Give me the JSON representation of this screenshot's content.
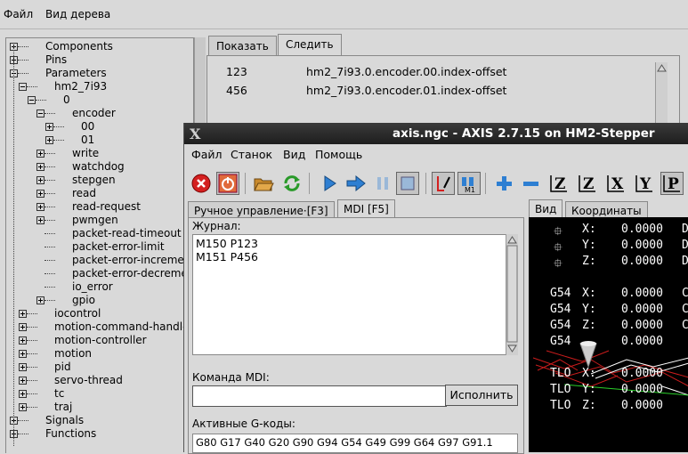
{
  "main_menu": {
    "file": "Файл",
    "tree_view": "Вид дерева"
  },
  "tree": [
    {
      "label": "Components",
      "expanded": false
    },
    {
      "label": "Pins",
      "expanded": false
    },
    {
      "label": "Parameters",
      "expanded": true
    },
    {
      "label": "hm2_7i93",
      "expanded": true
    },
    {
      "label": "0",
      "expanded": true
    },
    {
      "label": "encoder",
      "expanded": true
    },
    {
      "label": "00",
      "expanded": false
    },
    {
      "label": "01",
      "expanded": false
    },
    {
      "label": "write",
      "expanded": false
    },
    {
      "label": "watchdog",
      "expanded": false
    },
    {
      "label": "stepgen",
      "expanded": false
    },
    {
      "label": "read",
      "expanded": false
    },
    {
      "label": "read-request",
      "expanded": false
    },
    {
      "label": "pwmgen",
      "expanded": false
    },
    {
      "label": "packet-read-timeout",
      "expanded": null
    },
    {
      "label": "packet-error-limit",
      "expanded": null
    },
    {
      "label": "packet-error-increment",
      "expanded": null
    },
    {
      "label": "packet-error-decrement",
      "expanded": null
    },
    {
      "label": "io_error",
      "expanded": null
    },
    {
      "label": "gpio",
      "expanded": false
    },
    {
      "label": "iocontrol",
      "expanded": false
    },
    {
      "label": "motion-command-handler",
      "expanded": false
    },
    {
      "label": "motion-controller",
      "expanded": false
    },
    {
      "label": "motion",
      "expanded": false
    },
    {
      "label": "pid",
      "expanded": false
    },
    {
      "label": "servo-thread",
      "expanded": false
    },
    {
      "label": "tc",
      "expanded": false
    },
    {
      "label": "traj",
      "expanded": false
    },
    {
      "label": "Signals",
      "expanded": false
    },
    {
      "label": "Functions",
      "expanded": false
    }
  ],
  "top_tabs": {
    "show": "Показать",
    "watch": "Следить"
  },
  "watch": [
    {
      "value": "123",
      "name": "hm2_7i93.0.encoder.00.index-offset"
    },
    {
      "value": "456",
      "name": "hm2_7i93.0.encoder.01.index-offset"
    }
  ],
  "axis": {
    "title": "axis.ngc - AXIS 2.7.15 on HM2-Stepper",
    "menu": {
      "file": "Файл",
      "machine": "Станок",
      "view": "Вид",
      "help": "Помощь"
    },
    "tabs": {
      "manual": "Ручное управление·[F3]",
      "mdi": "MDI [F5]",
      "preview": "Вид",
      "dro": "Координаты"
    },
    "journal_label": "Журнал:",
    "journal": [
      "M150 P123",
      "M151 P456"
    ],
    "mdi_label": "Команда MDI:",
    "mdi_value": "",
    "run_button": "Исполнить",
    "gcodes_label": "Активные G-коды:",
    "gcodes": "G80 G17 G40 G20 G90 G94 G54 G49 G99 G64 G97 G91.1",
    "dro": [
      {
        "prefix": "",
        "axis": "X:",
        "value": "0.0000",
        "extra": "D"
      },
      {
        "prefix": "",
        "axis": "Y:",
        "value": "0.0000",
        "extra": "D"
      },
      {
        "prefix": "",
        "axis": "Z:",
        "value": "0.0000",
        "extra": "D"
      },
      {
        "prefix": "G54",
        "axis": "X:",
        "value": "0.0000",
        "extra": "C"
      },
      {
        "prefix": "G54",
        "axis": "Y:",
        "value": "0.0000",
        "extra": "C"
      },
      {
        "prefix": "G54",
        "axis": "Z:",
        "value": "0.0000",
        "extra": "C"
      },
      {
        "prefix": "G54",
        "axis": "",
        "value": "0.0000",
        "extra": ""
      },
      {
        "prefix": "TLO",
        "axis": "X:",
        "value": "0.0000",
        "extra": ""
      },
      {
        "prefix": "TLO",
        "axis": "Y:",
        "value": "0.0000",
        "extra": ""
      },
      {
        "prefix": "TLO",
        "axis": "Z:",
        "value": "0.0000",
        "extra": ""
      }
    ],
    "toolbar_icons": [
      "estop-icon",
      "power-icon",
      "open-icon",
      "reload-icon",
      "run-icon",
      "step-icon",
      "pause-icon",
      "stop-icon",
      "block-delete-icon",
      "optional-stop-icon",
      "zoom-in-icon",
      "zoom-out-icon",
      "view-z-icon",
      "view-z2-icon",
      "view-x-icon",
      "view-y-icon",
      "view-p-icon"
    ],
    "toolbar_letters": {
      "z": "Z",
      "z2": "Z",
      "x": "X",
      "y": "Y",
      "p": "P",
      "m1": "M1"
    }
  },
  "colors": {
    "titlebar": "#262626",
    "preview_bg": "#000000",
    "estop_red": "#d42020"
  }
}
